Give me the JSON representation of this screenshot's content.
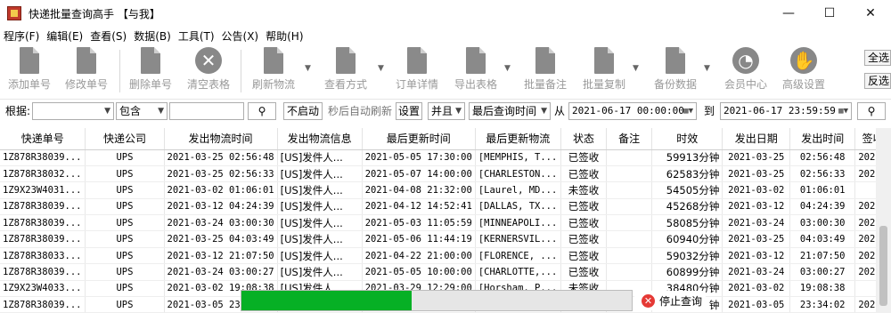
{
  "window": {
    "title": "快递批量查询高手 【与我】",
    "minimize": "—",
    "maximize": "☐",
    "close": "✕"
  },
  "menu": [
    "程序(F)",
    "编辑(E)",
    "查看(S)",
    "数据(B)",
    "工具(T)",
    "公告(X)",
    "帮助(H)"
  ],
  "toolbar": {
    "add": "添加单号",
    "edit": "修改单号",
    "delete": "删除单号",
    "clear": "清空表格",
    "refresh": "刷新物流",
    "view_mode": "查看方式",
    "order_detail": "订单详情",
    "export": "导出表格",
    "batch_note": "批量备注",
    "batch_copy": "批量复制",
    "backup": "备份数据",
    "member": "会员中心",
    "advanced": "高级设置",
    "select_all": "全选",
    "invert": "反选"
  },
  "filter": {
    "label": "根据:",
    "field_value": "",
    "match_mode": "包含",
    "keyword": "",
    "auto_refresh_btn": "不启动",
    "auto_refresh_text": "秒后自动刷新",
    "settings_btn": "设置",
    "logic": "并且",
    "time_field": "最后查询时间",
    "from_label": "从",
    "from": "2021-06-17 00:00:00",
    "to_label": "到",
    "to": "2021-06-17 23:59:59"
  },
  "table": {
    "columns": [
      "快递单号",
      "快递公司",
      "发出物流时间",
      "发出物流信息",
      "最后更新时间",
      "最后更新物流",
      "状态",
      "备注",
      "时效",
      "发出日期",
      "发出时间",
      "签收"
    ],
    "rows": [
      [
        "1Z878R38039...",
        "UPS",
        "2021-03-25 02:56:48",
        "[US]发件人...",
        "2021-05-05 17:30:00",
        "[MEMPHIS, T...",
        "已签收",
        "",
        "59913分钟",
        "2021-03-25",
        "02:56:48",
        "2021"
      ],
      [
        "1Z878R38032...",
        "UPS",
        "2021-03-25 02:56:33",
        "[US]发件人...",
        "2021-05-07 14:00:00",
        "[CHARLESTON...",
        "已签收",
        "",
        "62583分钟",
        "2021-03-25",
        "02:56:33",
        "2021"
      ],
      [
        "1Z9X23W4031...",
        "UPS",
        "2021-03-02 01:06:01",
        "[US]发件人...",
        "2021-04-08 21:32:00",
        "[Laurel, MD...",
        "未签收",
        "",
        "54505分钟",
        "2021-03-02",
        "01:06:01",
        ""
      ],
      [
        "1Z878R38039...",
        "UPS",
        "2021-03-12 04:24:39",
        "[US]发件人...",
        "2021-04-12 14:52:41",
        "[DALLAS, TX...",
        "已签收",
        "",
        "45268分钟",
        "2021-03-12",
        "04:24:39",
        "2021"
      ],
      [
        "1Z878R38039...",
        "UPS",
        "2021-03-24 03:00:30",
        "[US]发件人...",
        "2021-05-03 11:05:59",
        "[MINNEAPOLI...",
        "已签收",
        "",
        "58085分钟",
        "2021-03-24",
        "03:00:30",
        "2021"
      ],
      [
        "1Z878R38039...",
        "UPS",
        "2021-03-25 04:03:49",
        "[US]发件人...",
        "2021-05-06 11:44:19",
        "[KERNERSVIL...",
        "已签收",
        "",
        "60940分钟",
        "2021-03-25",
        "04:03:49",
        "2021"
      ],
      [
        "1Z878R38033...",
        "UPS",
        "2021-03-12 21:07:50",
        "[US]发件人...",
        "2021-04-22 21:00:00",
        "[FLORENCE, ...",
        "已签收",
        "",
        "59032分钟",
        "2021-03-12",
        "21:07:50",
        "2021"
      ],
      [
        "1Z878R38039...",
        "UPS",
        "2021-03-24 03:00:27",
        "[US]发件人...",
        "2021-05-05 10:00:00",
        "[CHARLOTTE,...",
        "已签收",
        "",
        "60899分钟",
        "2021-03-24",
        "03:00:27",
        "2021"
      ],
      [
        "1Z9X23W4033...",
        "UPS",
        "2021-03-02 19:08:38",
        "[US]发件人...",
        "2021-03-29 12:29:00",
        "[Horsham, P...",
        "未签收",
        "",
        "38480分钟",
        "2021-03-02",
        "19:08:38",
        ""
      ],
      [
        "1Z878R38039...",
        "UPS",
        "2021-03-05 23",
        "",
        "",
        "",
        "",
        "",
        "钟",
        "2021-03-05",
        "23:34:02",
        "2021"
      ]
    ]
  },
  "progress": {
    "value": 0.435,
    "stop_label": "停止查询"
  },
  "colors": {
    "progress_fill": "#06b025",
    "stop_icon": "#e53935"
  }
}
